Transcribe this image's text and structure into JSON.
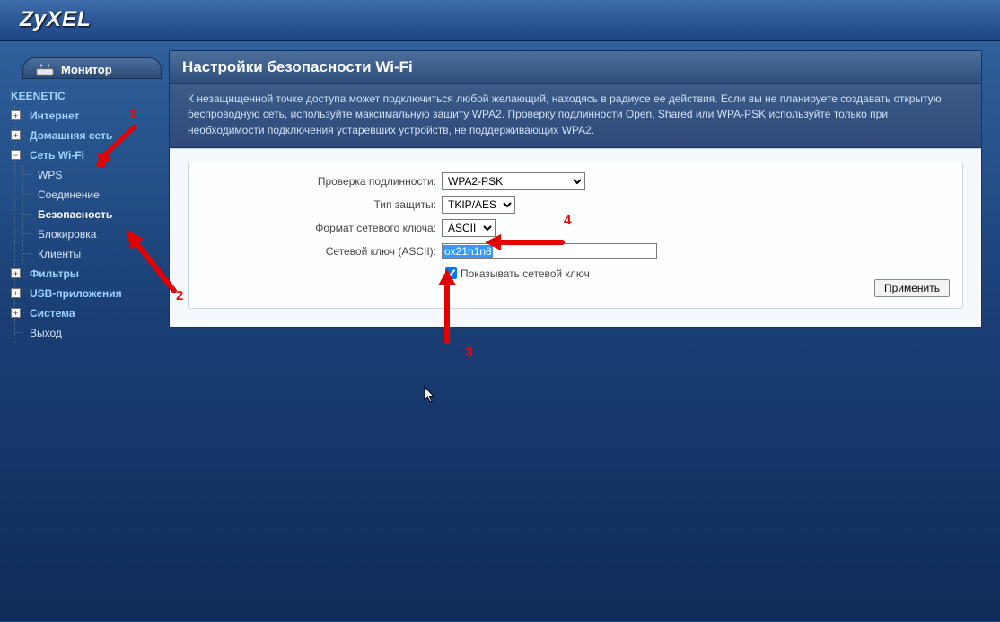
{
  "brand": "ZyXEL",
  "monitor_tab": "Монитор",
  "device_name": "KEENETIC",
  "nav": {
    "internet": "Интернет",
    "home": "Домашняя сеть",
    "wifi": "Сеть Wi-Fi",
    "wifi_sub": {
      "wps": "WPS",
      "conn": "Соединение",
      "security": "Безопасность",
      "block": "Блокировка",
      "clients": "Клиенты"
    },
    "filters": "Фильтры",
    "usb": "USB-приложения",
    "system": "Система",
    "exit": "Выход"
  },
  "panel": {
    "title": "Настройки безопасности Wi-Fi",
    "info": "К незащищенной точке доступа может подключиться любой желающий, находясь в радиусе ее действия. Если вы не планируете создавать открытую беспроводную сеть, используйте максимальную защиту WPA2. Проверку подлинности Open, Shared или WPA-PSK используйте только при необходимости подключения устаревших устройств, не поддерживающих WPA2."
  },
  "form": {
    "auth_label": "Проверка подлинности:",
    "auth_value": "WPA2-PSK",
    "prot_label": "Тип защиты:",
    "prot_value": "TKIP/AES",
    "fmt_label": "Формат сетевого ключа:",
    "fmt_value": "ASCII",
    "key_label": "Сетевой ключ (ASCII):",
    "key_value": "ox21h1n8",
    "show_key": "Показывать сетевой ключ",
    "apply": "Применить"
  },
  "annotations": {
    "a1": "1",
    "a2": "2",
    "a3": "3",
    "a4": "4"
  }
}
